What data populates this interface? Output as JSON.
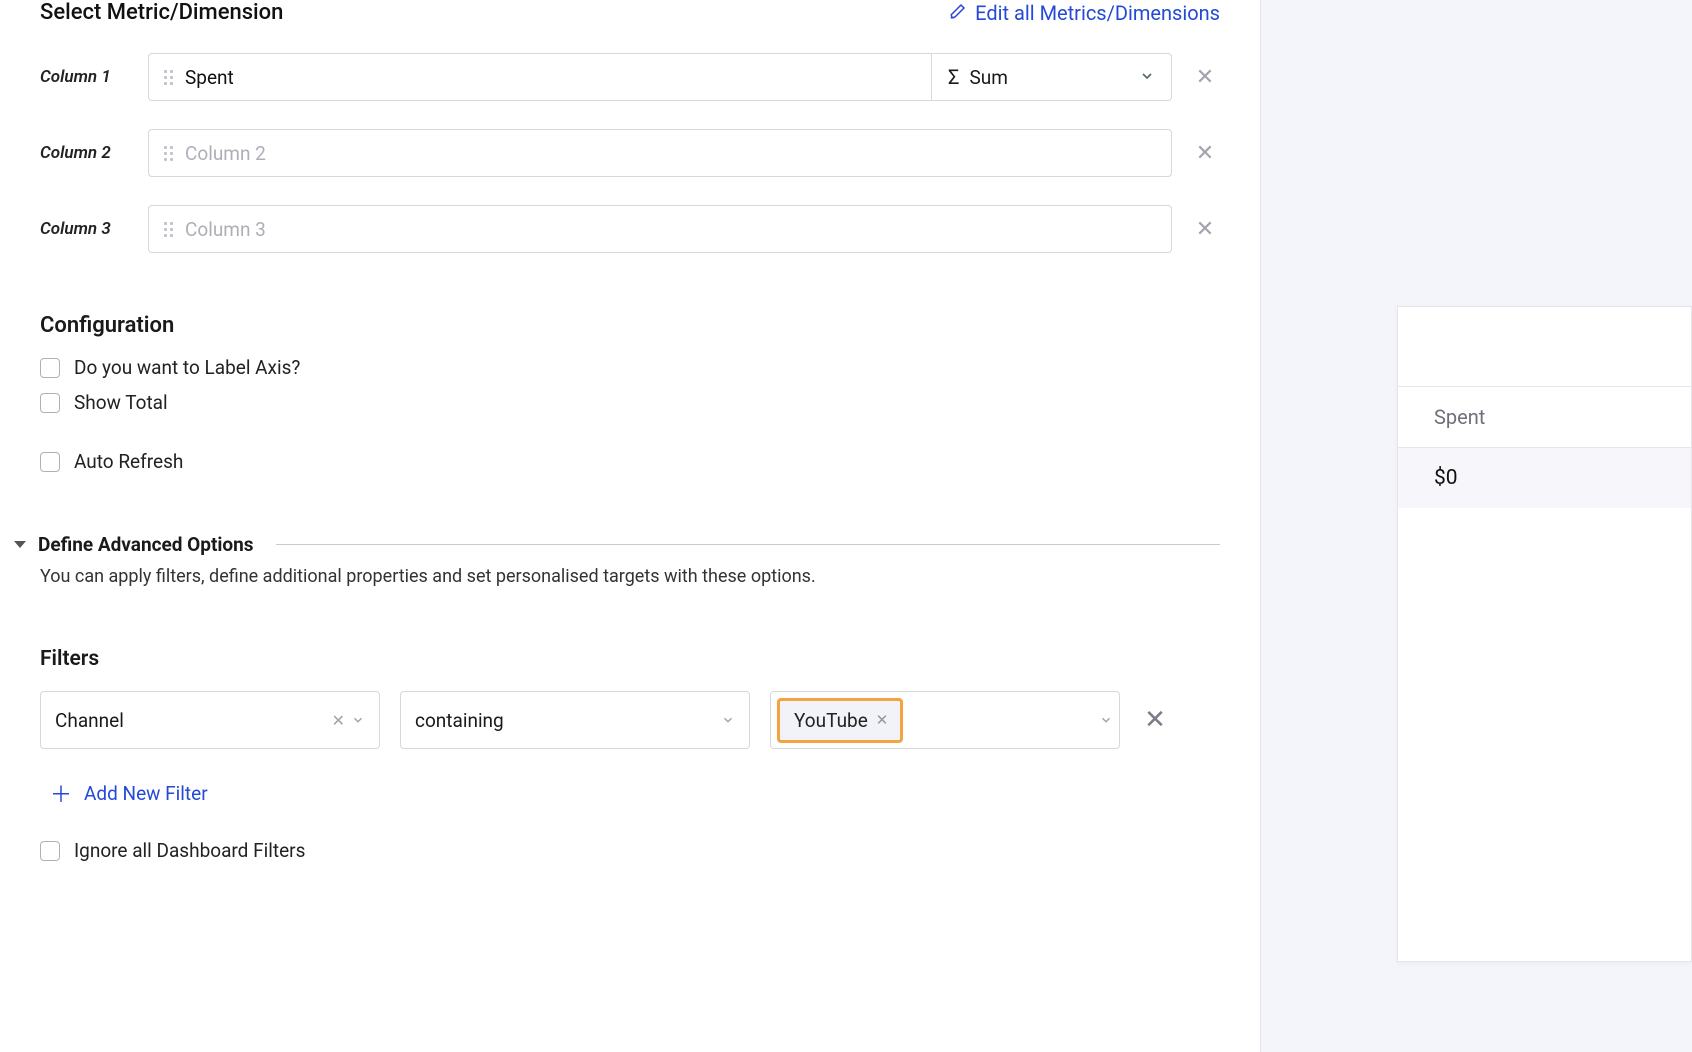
{
  "header": {
    "title": "Select Metric/Dimension",
    "edit_link": "Edit all Metrics/Dimensions"
  },
  "columns": [
    {
      "label": "Column 1",
      "value": "Spent",
      "placeholder": "",
      "aggregation": "Sum",
      "aggregation_symbol": "Σ",
      "has_agg": true
    },
    {
      "label": "Column 2",
      "value": "",
      "placeholder": "Column 2",
      "has_agg": false
    },
    {
      "label": "Column 3",
      "value": "",
      "placeholder": "Column 3",
      "has_agg": false
    }
  ],
  "configuration": {
    "title": "Configuration",
    "label_axis": "Do you want to Label Axis?",
    "show_total": "Show Total",
    "auto_refresh": "Auto Refresh"
  },
  "advanced": {
    "title": "Define Advanced Options",
    "description": "You can apply filters, define additional properties and set personalised targets with these options."
  },
  "filters": {
    "title": "Filters",
    "row": {
      "field": "Channel",
      "operator": "containing",
      "value_tag": "YouTube"
    },
    "add_label": "Add New Filter",
    "ignore_label": "Ignore all Dashboard Filters"
  },
  "preview": {
    "column_header": "Spent",
    "row_value": "$0"
  }
}
